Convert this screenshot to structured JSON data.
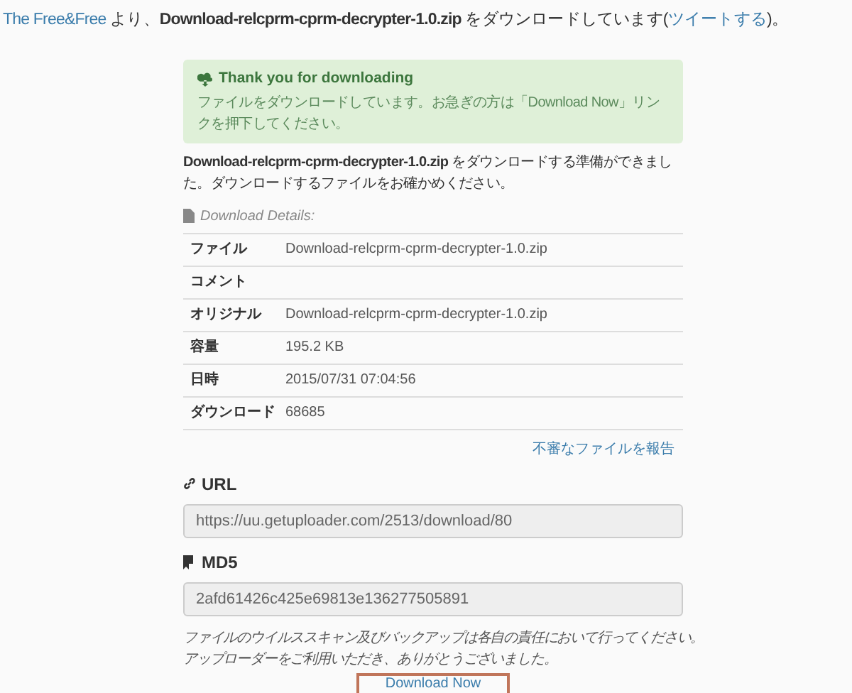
{
  "heading": {
    "uploader_link": "The Free&Free",
    "text_1": " より、",
    "filename": "Download-relcprm-cprm-decrypter-1.0.zip",
    "text_2": " をダウンロードしています(",
    "tweet_link": "ツイートする",
    "text_3": ")。"
  },
  "alert": {
    "title": "Thank you for downloading",
    "message": "ファイルをダウンロードしています。お急ぎの方は「Download Now」リンクを押下してください。"
  },
  "ready_message": "**Download-relcprm-cprm-decrypter-1.0.zip** をダウンロードする準備ができました。ダウンロードするファイルをお確かめください。",
  "details": {
    "title": "Download Details:",
    "rows": [
      {
        "label": "ファイル",
        "value": "Download-relcprm-cprm-decrypter-1.0.zip"
      },
      {
        "label": "コメント"
      },
      {
        "label": "オリジナル",
        "value": "Download-relcprm-cprm-decrypter-1.0.zip"
      },
      {
        "label": "容量",
        "value": "195.2 KB"
      },
      {
        "label": "日時",
        "value": "2015/07/31 07:04:56"
      },
      {
        "label": "ダウンロード",
        "value": "68685"
      }
    ]
  },
  "report_link": "不審なファイルを報告",
  "url": {
    "label": "URL",
    "value": "https://uu.getuploader.com/2513/download/80"
  },
  "md5": {
    "label": "MD5",
    "value": "2afd61426c425e69813e136277505891"
  },
  "notice_lines": [
    "ファイルのウイルススキャン及びバックアップは各自の責任において行ってください。",
    "アップローダーをご利用いただき、ありがとうございました。"
  ],
  "download_button": "Download Now"
}
